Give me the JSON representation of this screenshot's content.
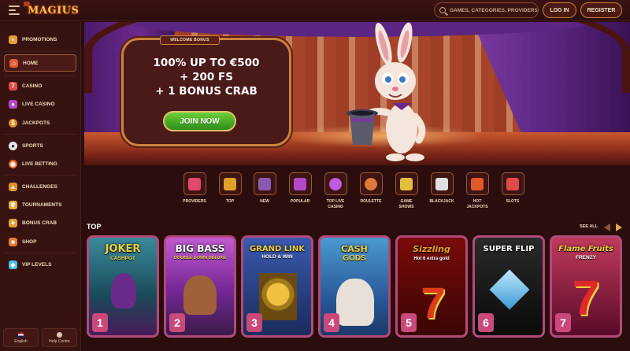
{
  "header": {
    "logo": "MAGIUS",
    "search_placeholder": "GAMES, CATEGORIES, PROVIDERS",
    "login_label": "LOG IN",
    "register_label": "REGISTER"
  },
  "sidebar": {
    "items": [
      {
        "label": "PROMOTIONS",
        "icon": "gift-icon",
        "color": "#e0a040"
      },
      {
        "label": "HOME",
        "icon": "house-icon",
        "color": "#e05a3a"
      },
      {
        "label": "CASINO",
        "icon": "slot-icon",
        "color": "#e04a4a"
      },
      {
        "label": "LIVE CASINO",
        "icon": "dealer-icon",
        "color": "#b04ac8"
      },
      {
        "label": "JACKPOTS",
        "icon": "coin-icon",
        "color": "#e08a2a"
      },
      {
        "label": "SPORTS",
        "icon": "ball-icon",
        "color": "#e0e0e0"
      },
      {
        "label": "LIVE BETTING",
        "icon": "live-icon",
        "color": "#e06a2a"
      },
      {
        "label": "CHALLENGES",
        "icon": "trophy-icon",
        "color": "#e0902a"
      },
      {
        "label": "TOURNAMENTS",
        "icon": "cup-icon",
        "color": "#e0b03a"
      },
      {
        "label": "BONUS CRAB",
        "icon": "crab-icon",
        "color": "#e0a03a"
      },
      {
        "label": "SHOP",
        "icon": "bag-icon",
        "color": "#e07a3a"
      },
      {
        "label": "VIP LEVELS",
        "icon": "diamond-icon",
        "color": "#4ac0e8"
      }
    ],
    "footer": {
      "language": "English",
      "help": "Help Centre"
    }
  },
  "hero": {
    "tag": "WELCOME BONUS",
    "line1": "100% UP TO €500",
    "line2": "+ 200 FS",
    "line3": "+ 1 BONUS CRAB",
    "cta": "JOIN NOW"
  },
  "categories": [
    {
      "label": "PROVIDERS",
      "icon": "book-icon",
      "color": "#e04a6a"
    },
    {
      "label": "TOP",
      "icon": "crown-icon",
      "color": "#e0a02a"
    },
    {
      "label": "NEW",
      "icon": "hat-icon",
      "color": "#8a5ab0"
    },
    {
      "label": "POPULAR",
      "icon": "jester-icon",
      "color": "#b04ac8"
    },
    {
      "label": "TOP LIVE\nCASINO",
      "icon": "blob-icon",
      "color": "#c05ae0"
    },
    {
      "label": "ROULETTE",
      "icon": "roulette-icon",
      "color": "#e07a3a"
    },
    {
      "label": "GAME\nSHOWS",
      "icon": "mic-icon",
      "color": "#e0c03a"
    },
    {
      "label": "BLACKJACK",
      "icon": "cards-icon",
      "color": "#e0e0e0"
    },
    {
      "label": "HOT\nJACKPOTS",
      "icon": "chest-icon",
      "color": "#e05a2a"
    },
    {
      "label": "SLOTS",
      "icon": "slots-icon",
      "color": "#e04a4a"
    }
  ],
  "top": {
    "title": "TOP",
    "see_all": "SEE ALL",
    "games": [
      {
        "rank": "1",
        "title": "JOKER",
        "sub": "CASHPOT",
        "bg": "#2a6a7a",
        "accent": "#f0d040"
      },
      {
        "rank": "2",
        "title": "BIG BASS",
        "sub": "DOUBLE DOWN DELUXE",
        "bg": "#8a3aa0",
        "accent": "#e03a3a"
      },
      {
        "rank": "3",
        "title": "GRAND LINK",
        "sub": "HOLD & WIN",
        "bg": "#2a4a8a",
        "accent": "#f0c040"
      },
      {
        "rank": "4",
        "title": "CASH",
        "sub": "GODS",
        "bg": "#2a6ab0",
        "accent": "#f0d040"
      },
      {
        "rank": "5",
        "title": "Sizzling",
        "sub": "Hot 6 extra gold",
        "bg": "#6a0a0a",
        "accent": "#f0a020"
      },
      {
        "rank": "6",
        "title": "SUPER FLIP",
        "sub": "",
        "bg": "#1a1a1a",
        "accent": "#e0e0e0"
      },
      {
        "rank": "7",
        "title": "Flame Fruits",
        "sub": "FRENZY",
        "bg": "#7a1a3a",
        "accent": "#f0a020"
      }
    ]
  }
}
